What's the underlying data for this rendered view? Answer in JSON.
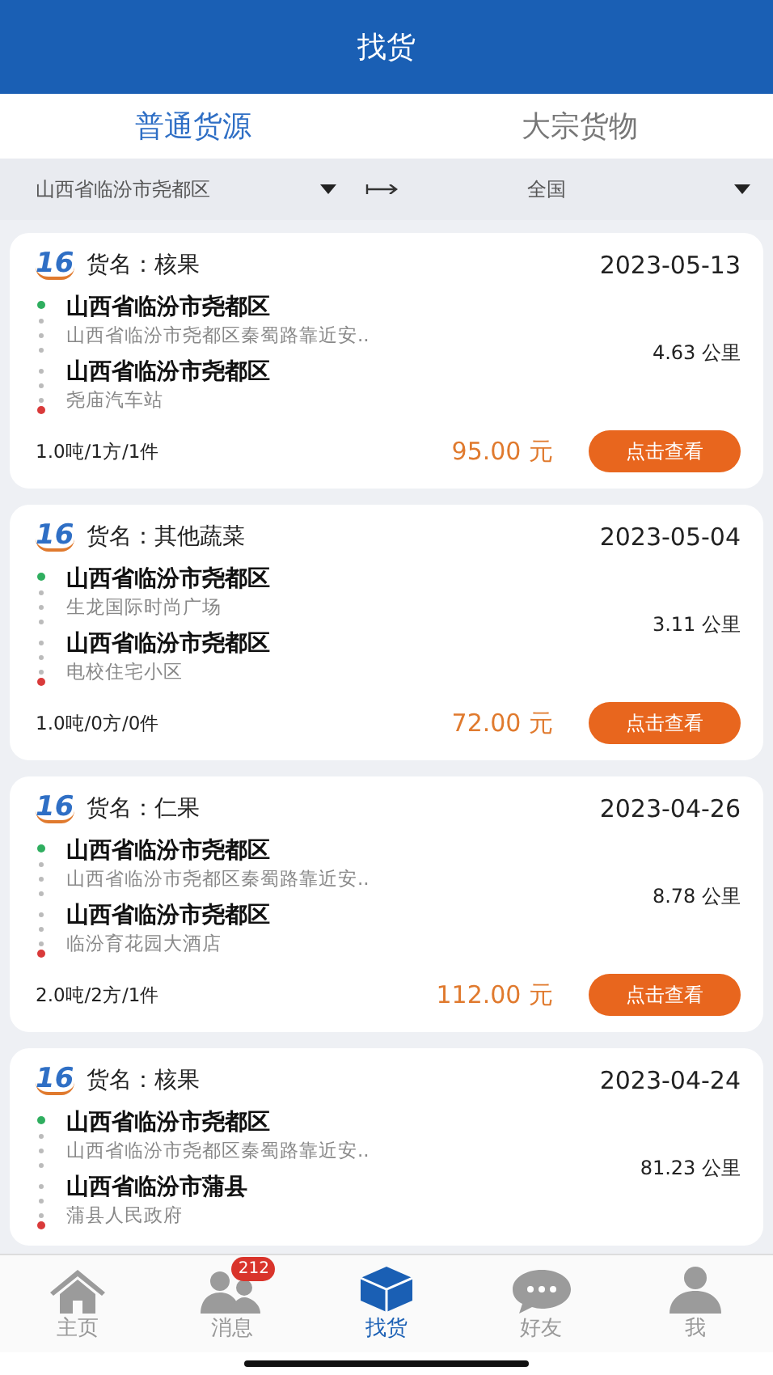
{
  "header": {
    "title": "找货"
  },
  "tabs": [
    {
      "label": "普通货源",
      "selected": true
    },
    {
      "label": "大宗货物",
      "selected": false
    }
  ],
  "filter": {
    "origin": "山西省临汾市尧都区",
    "destination": "全国"
  },
  "cargo": [
    {
      "logo": "16",
      "name": "货名：核果",
      "date": "2023-05-13",
      "distance": "4.63 公里",
      "stops": [
        {
          "kind": "origin",
          "city": "山西省临汾市尧都区",
          "address": "山西省临汾市尧都区秦蜀路靠近安.."
        },
        {
          "kind": "destination",
          "city": "山西省临汾市尧都区",
          "address": "尧庙汽车站"
        }
      ],
      "specs": "1.0吨/1方/1件",
      "price": "95.00 元",
      "button": "点击查看"
    },
    {
      "logo": "16",
      "name": "货名：其他蔬菜",
      "date": "2023-05-04",
      "distance": "3.11 公里",
      "stops": [
        {
          "kind": "origin",
          "city": "山西省临汾市尧都区",
          "address": "生龙国际时尚广场"
        },
        {
          "kind": "destination",
          "city": "山西省临汾市尧都区",
          "address": "电校住宅小区"
        }
      ],
      "specs": "1.0吨/0方/0件",
      "price": "72.00 元",
      "button": "点击查看"
    },
    {
      "logo": "16",
      "name": "货名：仁果",
      "date": "2023-04-26",
      "distance": "8.78 公里",
      "stops": [
        {
          "kind": "origin",
          "city": "山西省临汾市尧都区",
          "address": "山西省临汾市尧都区秦蜀路靠近安.."
        },
        {
          "kind": "destination",
          "city": "山西省临汾市尧都区",
          "address": "临汾育花园大酒店"
        }
      ],
      "specs": "2.0吨/2方/1件",
      "price": "112.00 元",
      "button": "点击查看"
    },
    {
      "logo": "16",
      "name": "货名：核果",
      "date": "2023-04-24",
      "distance": "81.23 公里",
      "stops": [
        {
          "kind": "origin",
          "city": "山西省临汾市尧都区",
          "address": "山西省临汾市尧都区秦蜀路靠近安.."
        },
        {
          "kind": "destination",
          "city": "山西省临汾市蒲县",
          "address": "蒲县人民政府"
        }
      ]
    }
  ],
  "nav": [
    {
      "kind": "home",
      "label": "主页",
      "selected": false
    },
    {
      "kind": "people",
      "label": "消息",
      "selected": false,
      "badge": "212"
    },
    {
      "kind": "box",
      "label": "找货",
      "selected": true
    },
    {
      "kind": "chat",
      "label": "好友",
      "selected": false
    },
    {
      "kind": "person",
      "label": "我",
      "selected": false
    }
  ]
}
